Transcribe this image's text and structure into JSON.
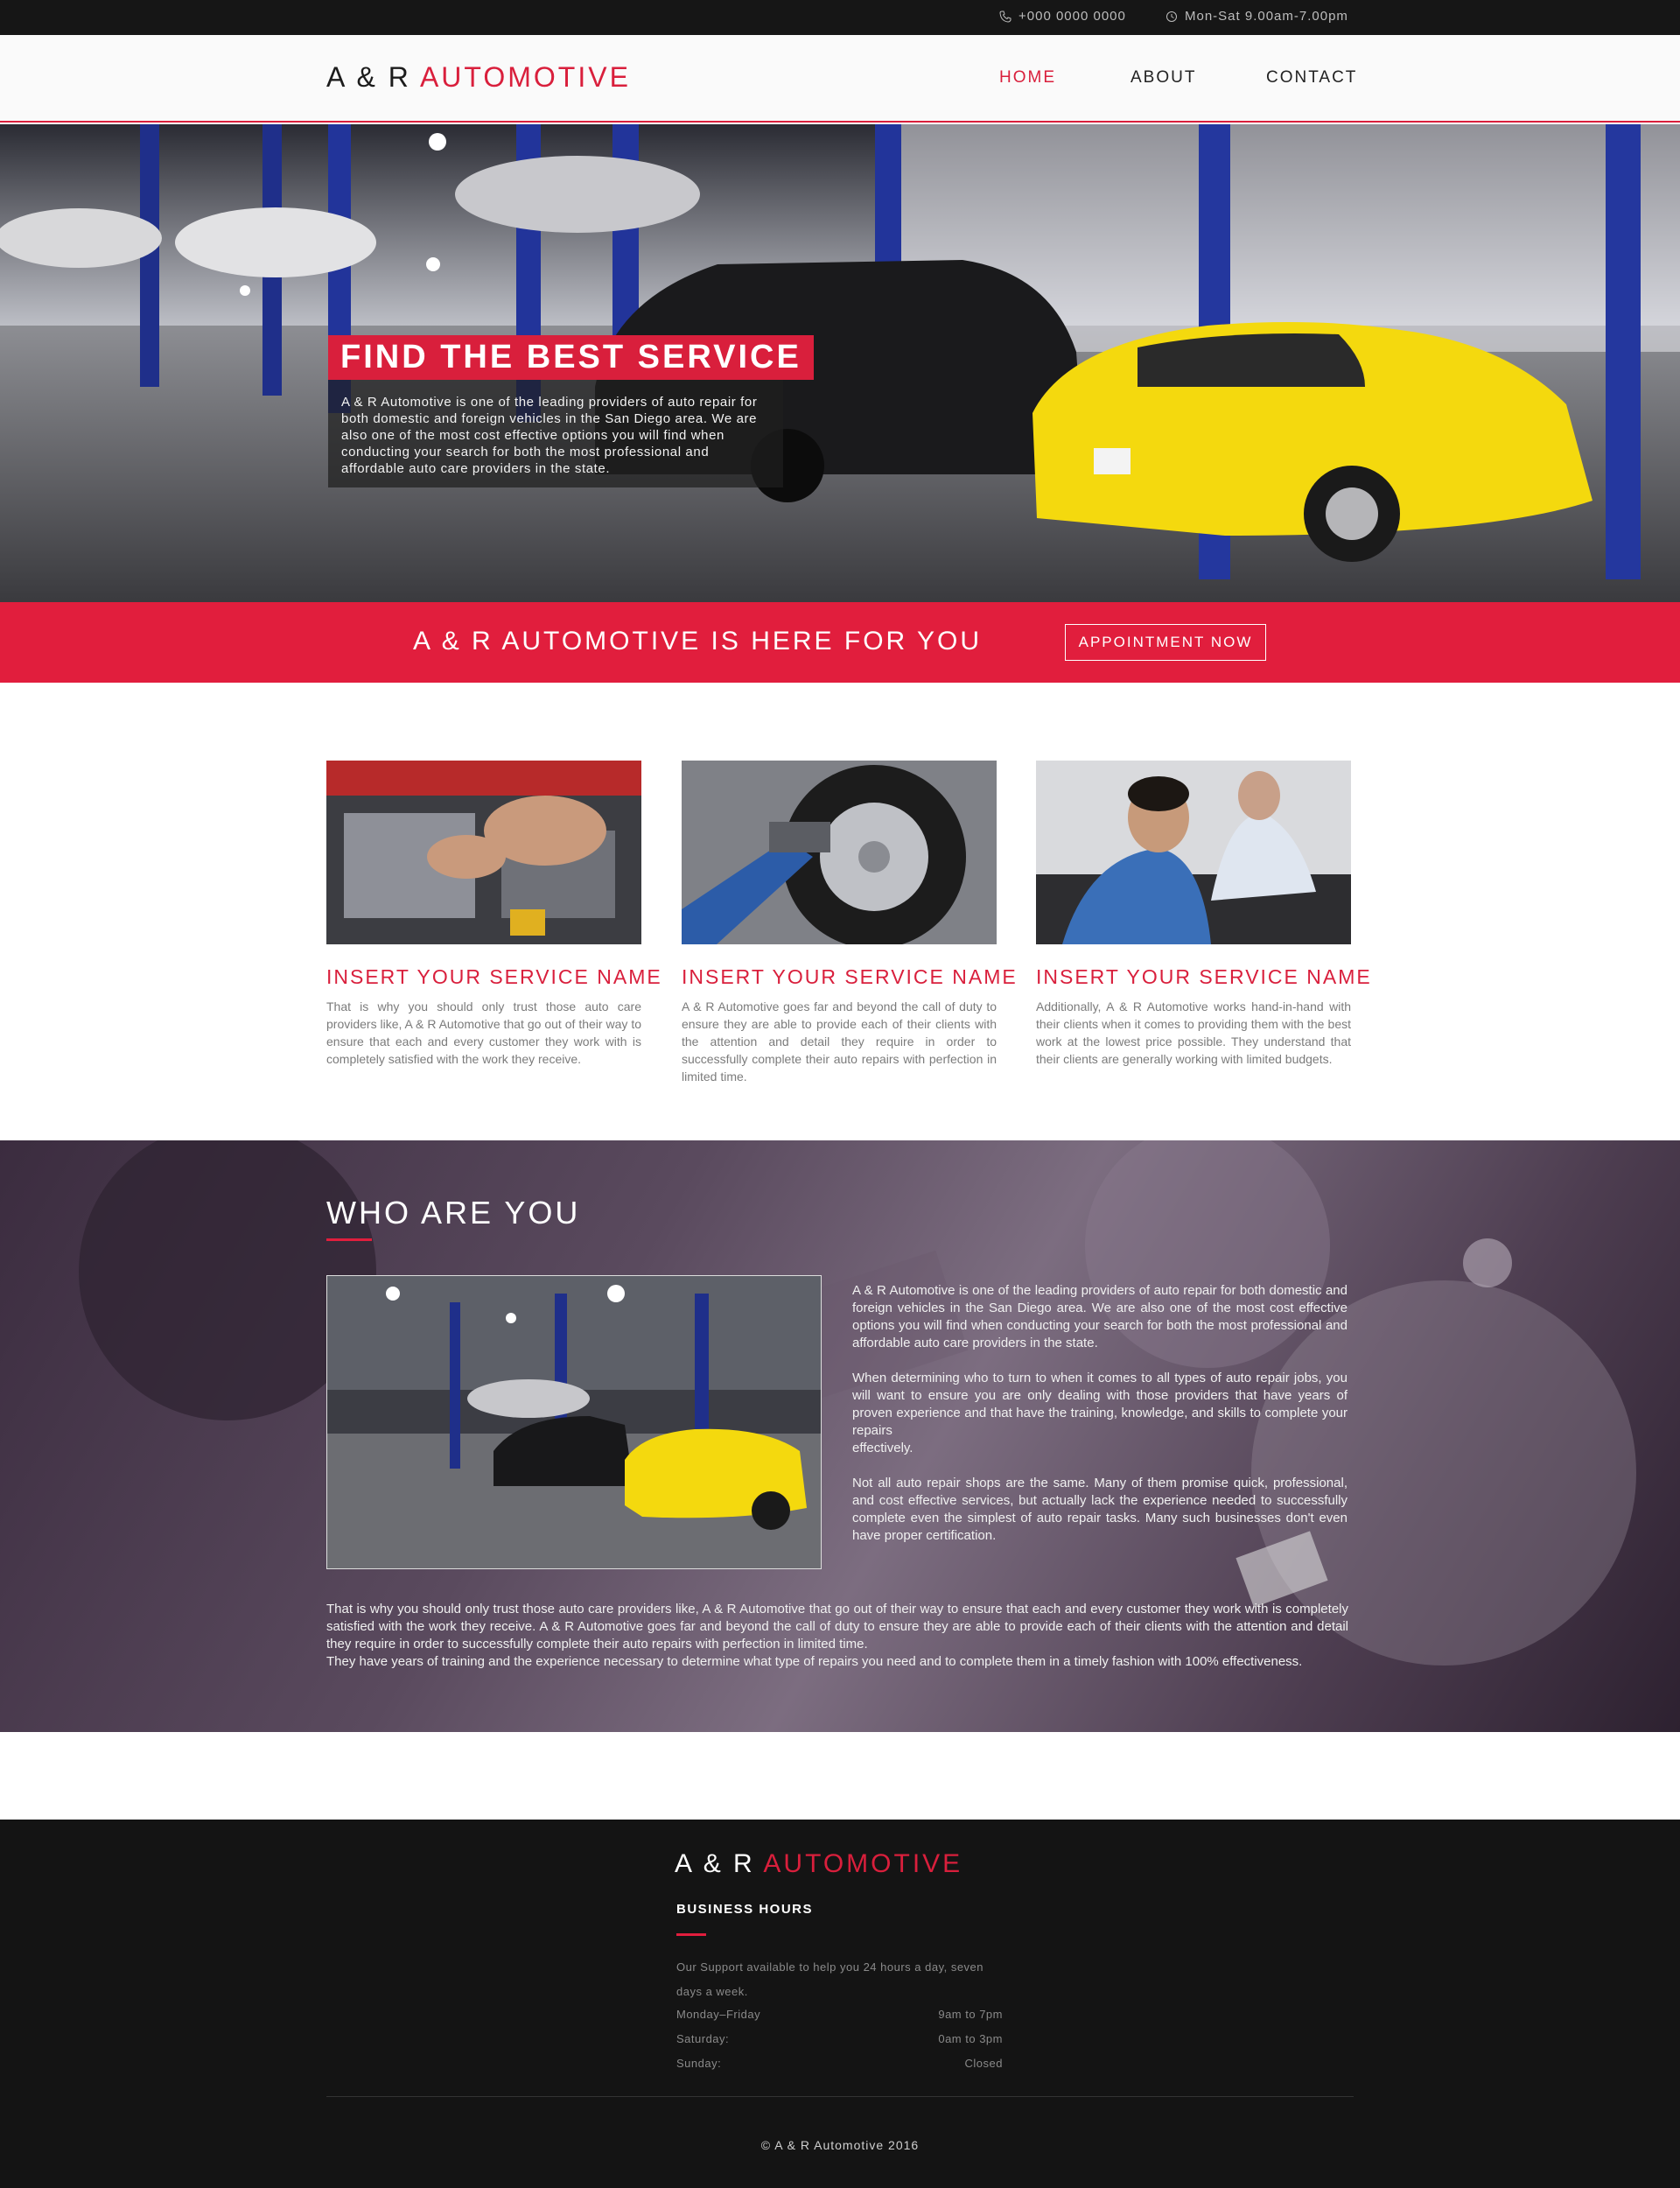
{
  "topbar": {
    "phone": "+000 0000 0000",
    "hours": "Mon-Sat 9.00am-7.00pm",
    "phone_icon": "phone-icon",
    "clock_icon": "clock-icon"
  },
  "header": {
    "logo_main": "A & R ",
    "logo_accent": "AUTOMOTIVE",
    "nav": [
      "HOME",
      "ABOUT",
      "CONTACT"
    ]
  },
  "hero": {
    "title": "FIND THE BEST SERVICE",
    "text": "A & R Automotive is one of the leading providers of auto repair for both domestic and foreign vehicles in the San Diego area. We are also one of the most cost effective options you will find when conducting your search for both the most professional and affordable auto care providers in the state."
  },
  "band": {
    "text": "A & R AUTOMOTIVE IS HERE FOR YOU",
    "button": "APPOINTMENT NOW"
  },
  "services": [
    {
      "title": "INSERT YOUR SERVICE NAME",
      "text": "That is why you should only trust those auto care providers like, A & R Automotive that go out of their way to ensure that each and every customer they work with is completely satisfied with the work they receive."
    },
    {
      "title": "INSERT YOUR SERVICE NAME",
      "text": "A & R Automotive goes far and beyond the call of duty to ensure they are able to provide each of their clients with the attention and detail they require in order to successfully complete their auto repairs with perfection in limited time."
    },
    {
      "title": "INSERT YOUR SERVICE NAME",
      "text": "Additionally, A & R Automotive works hand-in-hand with their clients when it comes to providing them with the best work at the lowest price possible. They understand that their clients are generally working with limited budgets."
    }
  ],
  "who": {
    "title": "WHO ARE YOU",
    "paragraphs": [
      "A & R Automotive is one of the leading providers of auto repair for both domestic and foreign vehicles in the San Diego area. We are also one of the most cost effective options you will find when conducting your search for both the most professional and affordable auto care providers in the state.",
      "When determining who to turn to when it comes to all types of auto repair jobs, you will want to ensure you are only dealing with those providers that have years of proven experience and that have the training, knowledge, and skills to complete your repairs\neffectively.",
      "Not all auto repair shops are the same. Many of them promise quick, professional, and cost effective services, but actually lack the experience needed to successfully complete even the simplest of auto repair tasks. Many such businesses don't even have proper certification."
    ],
    "bottom": "That is why you should only trust those auto care providers like, A & R Automotive that go out of their way to ensure that each and every customer they work with is completely satisfied with the work they receive. A & R Automotive goes far and beyond the call of duty to ensure they are able to provide each of their clients with the attention and detail they require in order to successfully complete their auto repairs with perfection in limited time.\nThey have years of training and the experience necessary to determine what type of repairs you need and to complete them in a timely fashion with 100% effectiveness."
  },
  "footer": {
    "logo_main": "A & R ",
    "logo_accent": "AUTOMOTIVE",
    "heading": "BUSINESS HOURS",
    "description": "Our Support available to help you 24 hours a day, seven days a week.",
    "hours": [
      {
        "day": "Monday–Friday",
        "time": "9am to 7pm"
      },
      {
        "day": "Saturday:",
        "time": "0am to 3pm"
      },
      {
        "day": "Sunday:",
        "time": "Closed"
      }
    ],
    "copyright": "© A & R Automotive 2016"
  },
  "colors": {
    "accent": "#e11e3d",
    "dark": "#141414"
  }
}
